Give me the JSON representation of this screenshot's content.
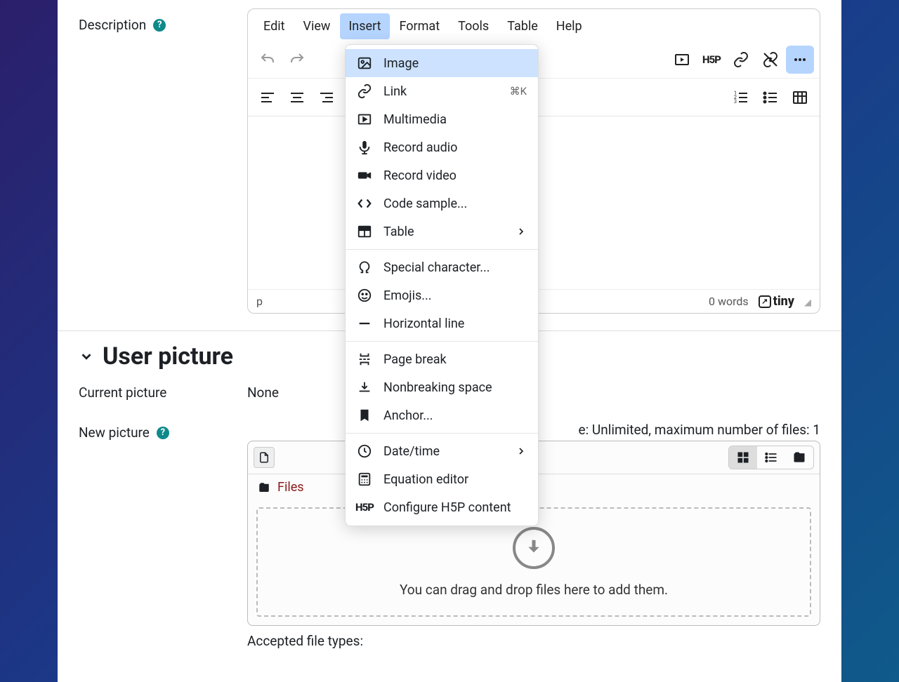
{
  "form": {
    "description_label": "Description"
  },
  "editor": {
    "menu": {
      "edit": "Edit",
      "view": "View",
      "insert": "Insert",
      "format": "Format",
      "tools": "Tools",
      "table": "Table",
      "help": "Help"
    },
    "insert_menu": {
      "image": "Image",
      "link": "Link",
      "link_shortcut": "⌘K",
      "multimedia": "Multimedia",
      "record_audio": "Record audio",
      "record_video": "Record video",
      "code_sample": "Code sample...",
      "table": "Table",
      "special_char": "Special character...",
      "emojis": "Emojis...",
      "horizontal_line": "Horizontal line",
      "page_break": "Page break",
      "nbsp": "Nonbreaking space",
      "anchor": "Anchor...",
      "datetime": "Date/time",
      "equation": "Equation editor",
      "h5p": "Configure H5P content"
    },
    "status": {
      "path": "p",
      "wordcount": "0 words",
      "brand": "tiny"
    }
  },
  "user_picture": {
    "heading": "User picture",
    "current_label": "Current picture",
    "current_value": "None",
    "new_label": "New picture",
    "file_limits_prefix": "e: Unlimited, maximum number of files: 1",
    "breadcrumb": "Files",
    "drop_text": "You can drag and drop files here to add them.",
    "accepted_label": "Accepted file types:"
  }
}
